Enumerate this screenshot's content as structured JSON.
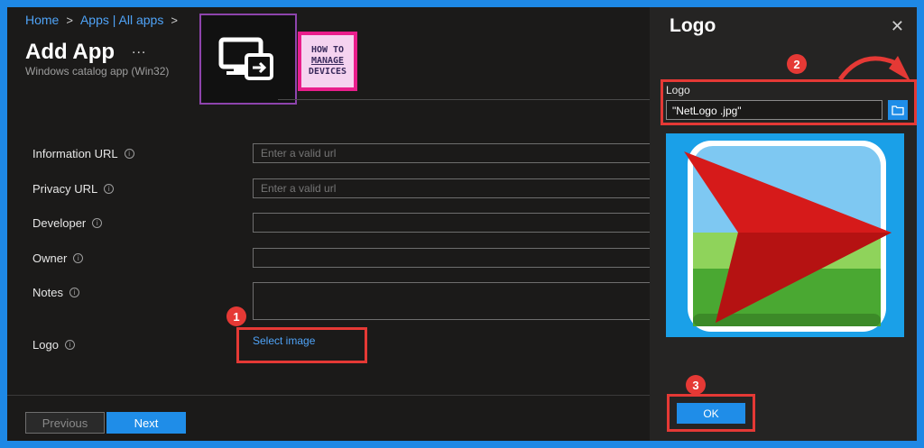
{
  "breadcrumb": {
    "home": "Home",
    "apps": "Apps | All apps"
  },
  "page": {
    "title": "Add App",
    "subtitle": "Windows catalog app (Win32)",
    "more": "..."
  },
  "brand": {
    "line1": "HOW TO",
    "line2": "MANAGE",
    "line3": "DEVICES"
  },
  "form": {
    "information_url": {
      "label": "Information URL",
      "placeholder": "Enter a valid url"
    },
    "privacy_url": {
      "label": "Privacy URL",
      "placeholder": "Enter a valid url"
    },
    "developer": {
      "label": "Developer"
    },
    "owner": {
      "label": "Owner"
    },
    "notes": {
      "label": "Notes"
    },
    "logo": {
      "label": "Logo",
      "action": "Select image"
    }
  },
  "footer": {
    "previous": "Previous",
    "next": "Next"
  },
  "panel": {
    "title": "Logo",
    "field_label": "Logo",
    "file_value": "\"NetLogo .jpg\"",
    "ok": "OK"
  },
  "steps": [
    "1",
    "2",
    "3"
  ],
  "colors": {
    "accent": "#1f8de8",
    "highlight": "#e53935",
    "background": "#1b1a19"
  }
}
